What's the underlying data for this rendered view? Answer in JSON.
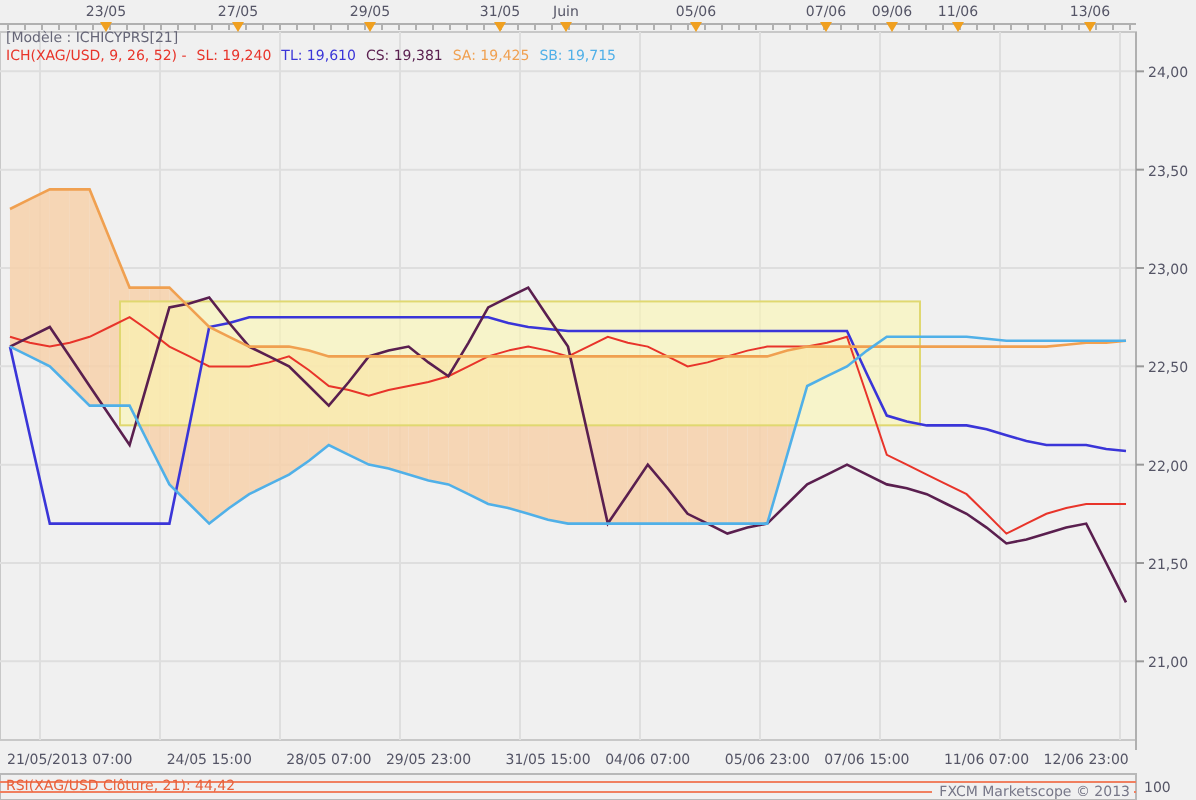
{
  "date_markers": [
    {
      "label": "23/05"
    },
    {
      "label": "27/05"
    },
    {
      "label": "29/05"
    },
    {
      "label": "31/05"
    },
    {
      "label": "Juin"
    },
    {
      "label": "05/06"
    },
    {
      "label": "07/06"
    },
    {
      "label": "09/06"
    },
    {
      "label": "11/06"
    },
    {
      "label": "13/06"
    }
  ],
  "legend": {
    "model": "[Modèle : ICHICYPRS[21]",
    "indicator": "ICH(XAG/USD, 9, 26, 52) -",
    "readings": [
      {
        "text": "SL: 19,240",
        "color": "#e8342a"
      },
      {
        "text": "TL: 19,610",
        "color": "#3a35d8"
      },
      {
        "text": "CS: 19,381",
        "color": "#5a1f4f"
      },
      {
        "text": "SA: 19,425",
        "color": "#f0a050"
      },
      {
        "text": "SB: 19,715",
        "color": "#50b0e8"
      }
    ]
  },
  "chart": {
    "chart_data": {
      "type": "line",
      "grid": true,
      "categories": [
        null,
        null,
        null,
        "21/05/2013 07:00",
        null,
        null,
        null,
        null,
        null,
        null,
        "24/05 15:00",
        null,
        null,
        null,
        null,
        null,
        "28/05 07:00",
        null,
        null,
        null,
        null,
        "29/05 23:00",
        null,
        null,
        null,
        null,
        null,
        "31/05 15:00",
        null,
        null,
        null,
        null,
        "04/06 07:00",
        null,
        null,
        null,
        null,
        null,
        "05/06 23:00",
        null,
        null,
        null,
        null,
        "07/06 15:00",
        null,
        null,
        null,
        null,
        null,
        "11/06 07:00",
        null,
        null,
        null,
        null,
        "12/06 23:00",
        null,
        null
      ],
      "series": [
        {
          "color": "#e8342a",
          "values": [
            22.65,
            22.62,
            22.6,
            22.62,
            22.65,
            22.7,
            22.75,
            22.68,
            22.6,
            22.55,
            22.5,
            22.5,
            22.5,
            22.52,
            22.55,
            22.48,
            22.4,
            22.38,
            22.35,
            22.38,
            22.4,
            22.42,
            22.45,
            22.5,
            22.55,
            22.58,
            22.6,
            22.58,
            22.55,
            22.6,
            22.65,
            22.62,
            22.6,
            22.55,
            22.5,
            22.52,
            22.55,
            22.58,
            22.6,
            22.6,
            22.6,
            22.62,
            22.65,
            22.35,
            22.05,
            22.0,
            21.95,
            21.9,
            21.85,
            21.75,
            21.65,
            21.7,
            21.75,
            21.78,
            21.8,
            21.8,
            21.8
          ]
        },
        {
          "color": "#3a35d8",
          "values": [
            22.6,
            22.15,
            21.7,
            21.7,
            21.7,
            21.7,
            21.7,
            21.7,
            21.7,
            22.2,
            22.7,
            22.72,
            22.75,
            22.75,
            22.75,
            22.75,
            22.75,
            22.75,
            22.75,
            22.75,
            22.75,
            22.75,
            22.75,
            22.75,
            22.75,
            22.72,
            22.7,
            22.69,
            22.68,
            22.68,
            22.68,
            22.68,
            22.68,
            22.68,
            22.68,
            22.68,
            22.68,
            22.68,
            22.68,
            22.68,
            22.68,
            22.68,
            22.68,
            22.46,
            22.25,
            22.22,
            22.2,
            22.2,
            22.2,
            22.18,
            22.15,
            22.12,
            22.1,
            22.1,
            22.1,
            22.08,
            22.07
          ]
        },
        {
          "color": "#5a1f4f",
          "values": [
            22.6,
            22.65,
            22.7,
            22.55,
            22.4,
            22.25,
            22.1,
            22.45,
            22.8,
            22.82,
            22.85,
            22.72,
            22.6,
            22.55,
            22.5,
            22.4,
            22.3,
            22.42,
            22.55,
            22.58,
            22.6,
            22.52,
            22.45,
            22.62,
            22.8,
            22.85,
            22.9,
            22.75,
            22.6,
            22.15,
            21.7,
            21.85,
            22.0,
            21.88,
            21.75,
            21.7,
            21.65,
            21.68,
            21.7,
            21.8,
            21.9,
            21.95,
            22.0,
            21.95,
            21.9,
            21.88,
            21.85,
            21.8,
            21.75,
            21.68,
            21.6,
            21.62,
            21.65,
            21.68,
            21.7,
            21.5,
            21.3
          ]
        },
        {
          "color": "#f0a050",
          "values": [
            23.3,
            23.35,
            23.4,
            23.4,
            23.4,
            23.15,
            22.9,
            22.9,
            22.9,
            22.8,
            22.7,
            22.65,
            22.6,
            22.6,
            22.6,
            22.58,
            22.55,
            22.55,
            22.55,
            22.55,
            22.55,
            22.55,
            22.55,
            22.55,
            22.55,
            22.55,
            22.55,
            22.55,
            22.55,
            22.55,
            22.55,
            22.55,
            22.55,
            22.55,
            22.55,
            22.55,
            22.55,
            22.55,
            22.55,
            22.58,
            22.6,
            22.6,
            22.6,
            22.6,
            22.6,
            22.6,
            22.6,
            22.6,
            22.6,
            22.6,
            22.6,
            22.6,
            22.6,
            22.61,
            22.62,
            22.62,
            22.63
          ]
        },
        {
          "color": "#50b0e8",
          "values": [
            22.6,
            22.55,
            22.5,
            22.4,
            22.3,
            22.3,
            22.3,
            22.1,
            21.9,
            21.8,
            21.7,
            21.78,
            21.85,
            21.9,
            21.95,
            22.02,
            22.1,
            22.05,
            22.0,
            21.98,
            21.95,
            21.92,
            21.9,
            21.85,
            21.8,
            21.78,
            21.75,
            21.72,
            21.7,
            21.7,
            21.7,
            21.7,
            21.7,
            21.7,
            21.7,
            21.7,
            21.7,
            21.7,
            21.7,
            22.05,
            22.4,
            22.45,
            22.5,
            22.58,
            22.65,
            22.65,
            22.65,
            22.65,
            22.65,
            22.64,
            22.63,
            22.63,
            22.63,
            22.63,
            22.63,
            22.63,
            22.63
          ]
        }
      ],
      "ylim": [
        20.6,
        24.2
      ],
      "yticks": [
        {
          "value": 21,
          "label": "21,00"
        },
        {
          "value": 21.5,
          "label": "21,50"
        },
        {
          "value": 22,
          "label": "22,00"
        },
        {
          "value": 22.5,
          "label": "22,50"
        },
        {
          "value": 23,
          "label": "23,00"
        },
        {
          "value": 23.5,
          "label": "23,50"
        },
        {
          "value": 24,
          "label": "24,00"
        }
      ]
    }
  },
  "rsi": {
    "label": "RSI(XAG/USD Clôture, 21): 44,42",
    "scale_label": "100"
  },
  "copyright": "FXCM Marketscope © 2013"
}
